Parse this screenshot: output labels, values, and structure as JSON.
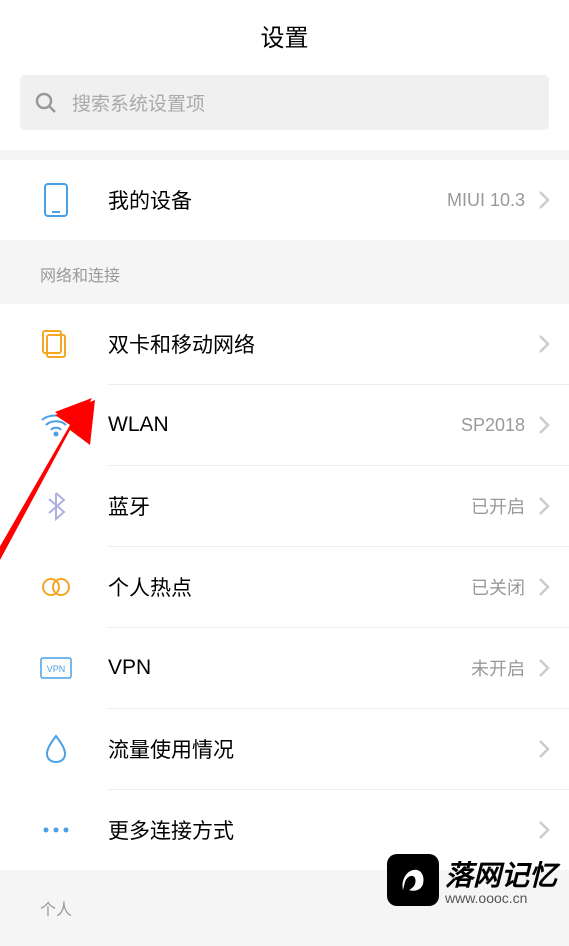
{
  "header": {
    "title": "设置"
  },
  "search": {
    "placeholder": "搜索系统设置项"
  },
  "device": {
    "label": "我的设备",
    "value": "MIUI 10.3"
  },
  "network_section": {
    "header": "网络和连接",
    "items": [
      {
        "label": "双卡和移动网络",
        "value": ""
      },
      {
        "label": "WLAN",
        "value": "SP2018"
      },
      {
        "label": "蓝牙",
        "value": "已开启"
      },
      {
        "label": "个人热点",
        "value": "已关闭"
      },
      {
        "label": "VPN",
        "value": "未开启"
      },
      {
        "label": "流量使用情况",
        "value": ""
      },
      {
        "label": "更多连接方式",
        "value": ""
      }
    ]
  },
  "personal_section": {
    "header": "个人"
  },
  "watermark": {
    "title": "落网记忆",
    "url": "www.oooc.cn"
  }
}
